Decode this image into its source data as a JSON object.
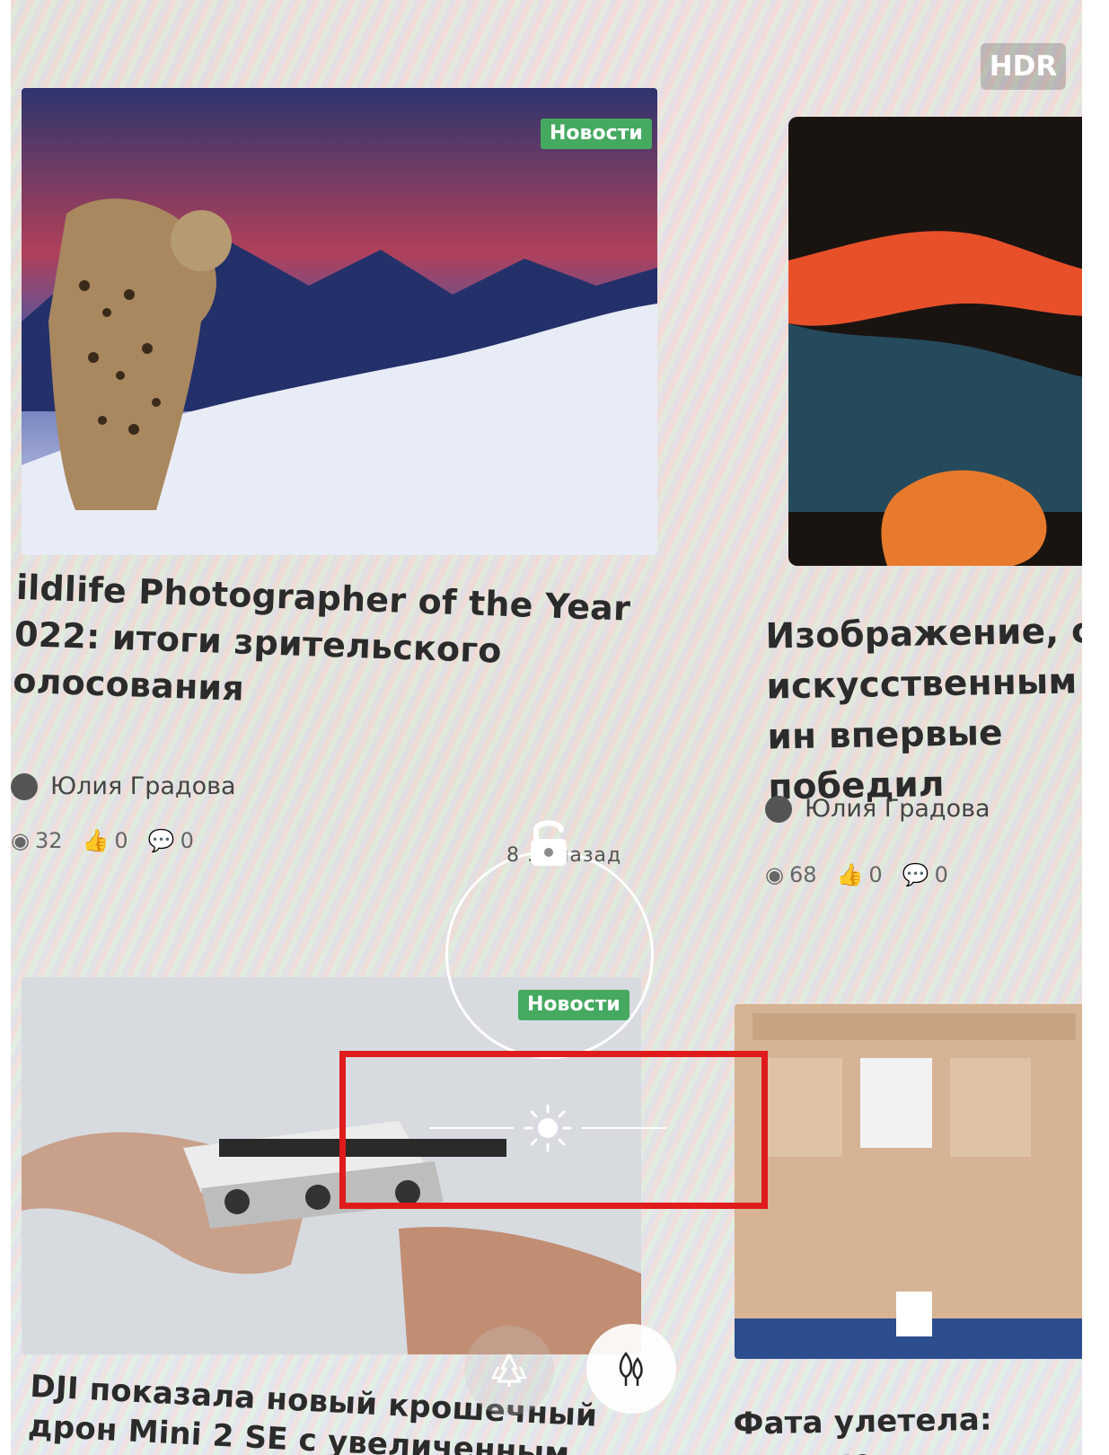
{
  "camera": {
    "hdr_label": "HDR",
    "focus_ring_text": "8 ... назад"
  },
  "articles": [
    {
      "tag": "Новости",
      "title": "ildlife Photographer of the Year 022: итоги зрительского олосования",
      "author": "Юлия Градова",
      "views": "32",
      "likes": "0",
      "comments": "0"
    },
    {
      "title": "Изображение, со искусственным ин впервые победил",
      "author": "Юлия Градова",
      "views": "68",
      "likes": "0",
      "comments": "0"
    },
    {
      "tag": "Новости",
      "title": "DJI показала новый крошечный дрон Mini 2 SE с увеличенным"
    },
    {
      "title": "Фата улетела: лучшие"
    }
  ],
  "icons": {
    "lock": "unlock-icon",
    "exposure": "sun-icon",
    "mode_a": "tree-outline-icon",
    "mode_b": "tree-filled-icon"
  },
  "colors": {
    "tag_green": "#45a960",
    "highlight_red": "#e01b1b"
  }
}
